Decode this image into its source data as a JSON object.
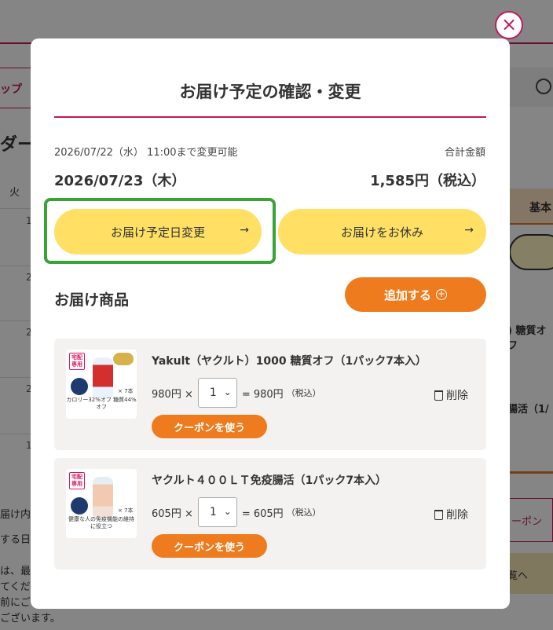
{
  "background": {
    "shop_tab": "ップ",
    "order_title": "ダー",
    "weekday": "火",
    "cal_dates": [
      "1",
      "2",
      "2",
      "2",
      "1"
    ],
    "right_tab": "基本",
    "right_text1": ") 糖質オフ",
    "right_text2": "腸活（1/",
    "right_coupon": "ーポン",
    "right_link": "覧へ",
    "left_lines": [
      "届け内",
      "する日",
      "は、最",
      "てくださ",
      "前にご",
      "ございます。"
    ]
  },
  "modal": {
    "close_symbol": "×",
    "title": "お届け予定の確認・変更",
    "deadline_text": "2026/07/22（水） 11:00まで変更可能",
    "total_label": "合計金額",
    "delivery_date": "2026/07/23（木）",
    "total_amount": "1,585円（税込）",
    "change_date_button": "お届け予定日変更",
    "skip_button": "お届けをお休み",
    "arrow": "→",
    "section_title": "お届け商品",
    "add_button": "追加する",
    "add_icon": "+"
  },
  "products": [
    {
      "name": "Yakult（ヤクルト）1000 糖質オフ（1パック7本入）",
      "unit_price": "980円 ×",
      "quantity": "1",
      "subtotal": "= 980円",
      "tax_note": "（税込）",
      "delete_label": "削除",
      "coupon_label": "クーポンを使う",
      "image": {
        "badge": "宅配専用",
        "caption": "カロリー32%オフ 糖質44%オフ",
        "count": "× 7本"
      }
    },
    {
      "name": "ヤクルト４００ＬＴ免疫腸活（1パック7本入）",
      "unit_price": "605円 ×",
      "quantity": "1",
      "subtotal": "= 605円",
      "tax_note": "（税込）",
      "delete_label": "削除",
      "coupon_label": "クーポンを使う",
      "image": {
        "badge": "宅配専用",
        "caption": "健康な人の免疫機能の維持に役立つ",
        "count": "× 7本"
      }
    }
  ],
  "colors": {
    "accent_pink": "#c2185b",
    "button_yellow": "#ffe065",
    "button_orange": "#ee7b1d",
    "highlight_green": "#3aa335",
    "card_bg": "#f4f2f0"
  }
}
